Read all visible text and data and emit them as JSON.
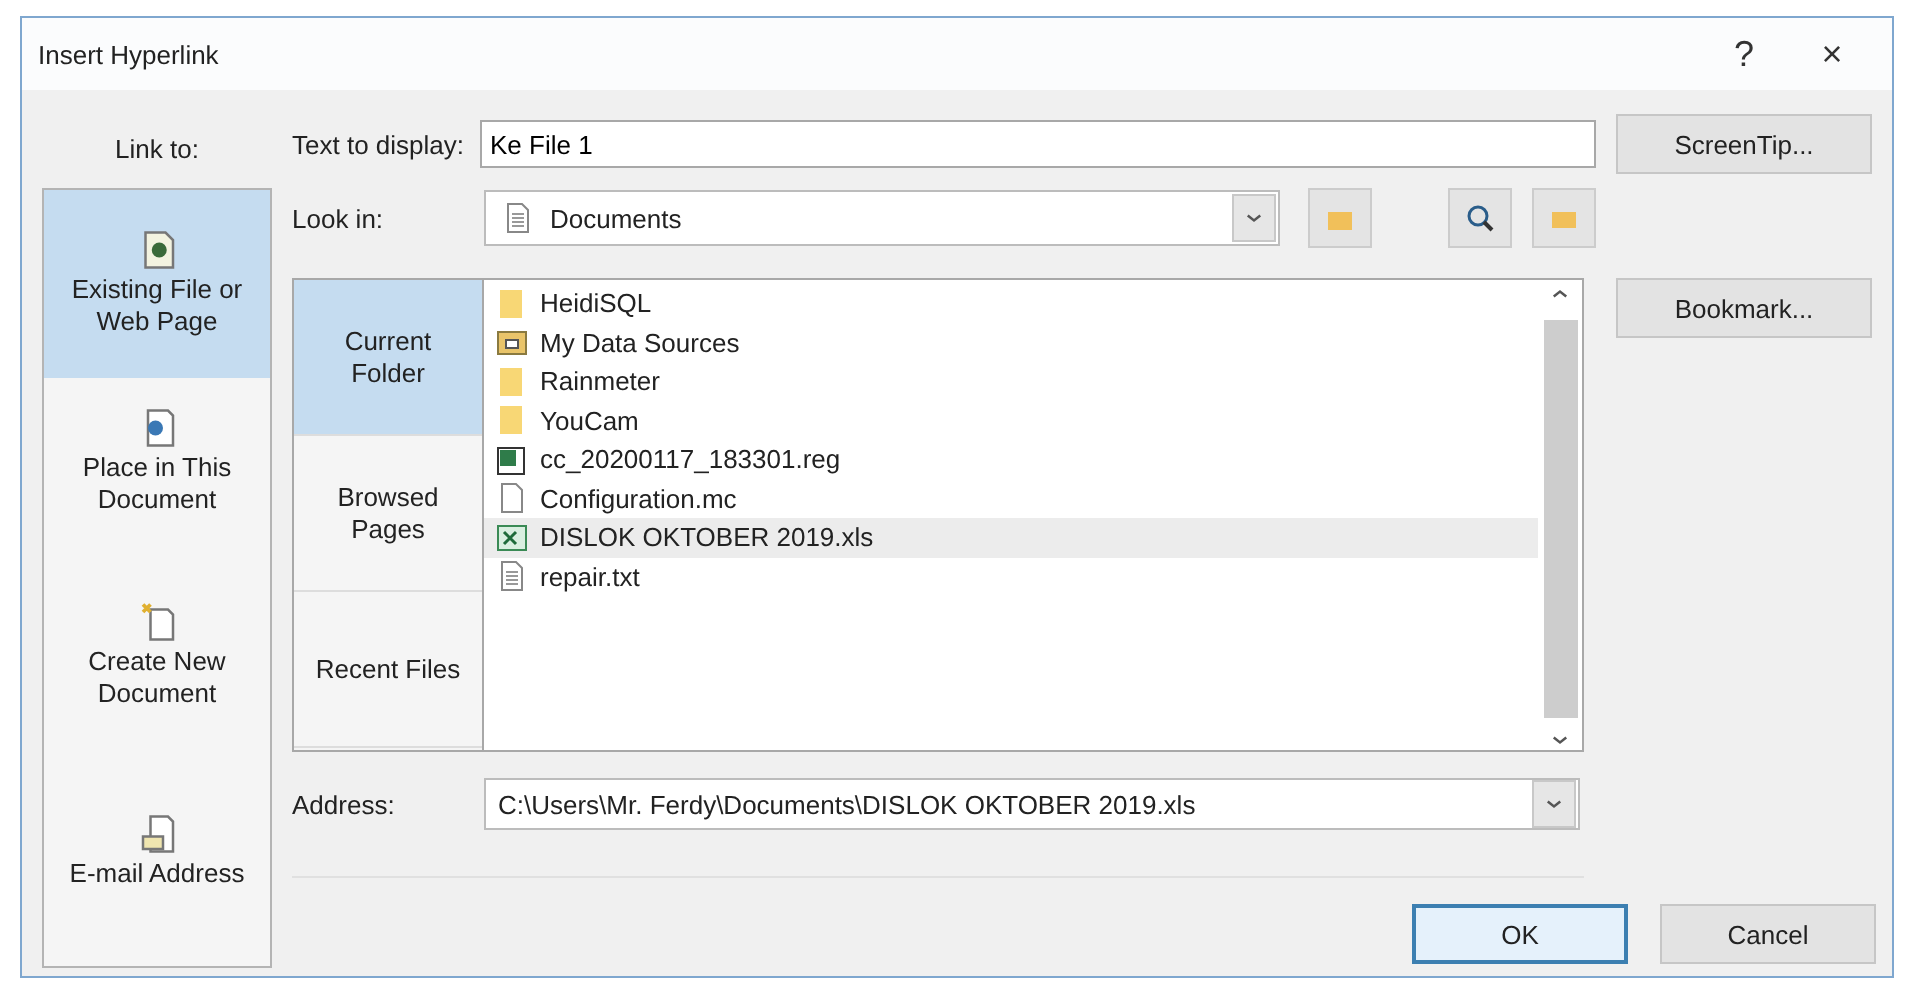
{
  "window": {
    "title": "Insert Hyperlink",
    "help": "?",
    "close": "×"
  },
  "link_to": {
    "label": "Link to:",
    "items": [
      {
        "label": "Existing File or Web Page",
        "kind": "file",
        "selected": true
      },
      {
        "label": "Place in This Document",
        "kind": "place",
        "selected": false
      },
      {
        "label": "Create New Document",
        "kind": "new",
        "selected": false
      },
      {
        "label": "E-mail Address",
        "kind": "email",
        "selected": false
      }
    ]
  },
  "text_to_display": {
    "label": "Text to display:",
    "value": "Ke File 1"
  },
  "screentip_button": "ScreenTip...",
  "look_in": {
    "label": "Look in:",
    "value": "Documents"
  },
  "locations": [
    {
      "label": "Current Folder",
      "selected": true
    },
    {
      "label": "Browsed Pages",
      "selected": false
    },
    {
      "label": "Recent Files",
      "selected": false
    }
  ],
  "files": [
    {
      "name": "HeidiSQL",
      "kind": "folder",
      "selected": false
    },
    {
      "name": "My Data Sources",
      "kind": "datafolder",
      "selected": false
    },
    {
      "name": "Rainmeter",
      "kind": "folder",
      "selected": false
    },
    {
      "name": "YouCam",
      "kind": "folder",
      "selected": false
    },
    {
      "name": "cc_20200117_183301.reg",
      "kind": "reg",
      "selected": false
    },
    {
      "name": "Configuration.mc",
      "kind": "blank",
      "selected": false
    },
    {
      "name": "DISLOK OKTOBER 2019.xls",
      "kind": "sheet",
      "selected": true
    },
    {
      "name": "repair.txt",
      "kind": "text",
      "selected": false
    }
  ],
  "bookmark_button": "Bookmark...",
  "address": {
    "label": "Address:",
    "value": "C:\\Users\\Mr. Ferdy\\Documents\\DISLOK OKTOBER 2019.xls"
  },
  "buttons": [
    {
      "label": "OK",
      "kind": "default"
    },
    {
      "label": "Cancel",
      "kind": "normal"
    }
  ]
}
